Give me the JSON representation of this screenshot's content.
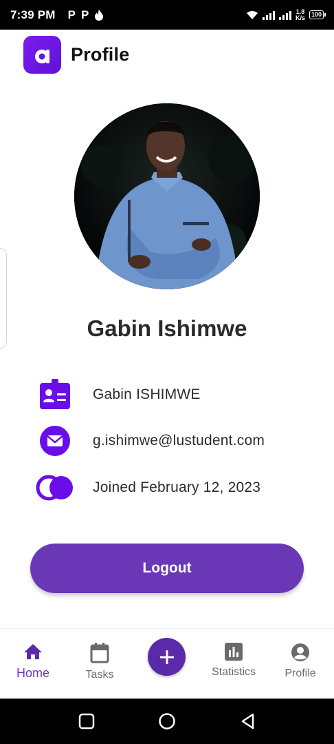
{
  "status_bar": {
    "time": "7:39 PM",
    "app_icons": [
      "P",
      "P"
    ],
    "speed_value": "1.8",
    "speed_unit": "K/s",
    "battery": "100"
  },
  "header": {
    "logo_letter": "a",
    "title": "Profile"
  },
  "profile": {
    "name": "Gabin Ishimwe",
    "details": [
      {
        "icon": "id-badge-icon",
        "text": "Gabin ISHIMWE"
      },
      {
        "icon": "mail-icon",
        "text": "g.ishimwe@lustudent.com"
      },
      {
        "icon": "toggle-icon",
        "text": "Joined February 12, 2023"
      }
    ]
  },
  "logout_label": "Logout",
  "bottom_nav": {
    "items": [
      {
        "label": "Home",
        "icon": "home-icon",
        "active": true
      },
      {
        "label": "Tasks",
        "icon": "calendar-icon",
        "active": false
      },
      {
        "label": "Statistics",
        "icon": "bar-chart-icon",
        "active": false
      },
      {
        "label": "Profile",
        "icon": "account-circle-icon",
        "active": false
      }
    ],
    "fab_icon": "plus-icon"
  },
  "colors": {
    "accent": "#6a38b7",
    "icon_purple": "#6a0ee8",
    "logo_purple": "#7a1cf0"
  }
}
